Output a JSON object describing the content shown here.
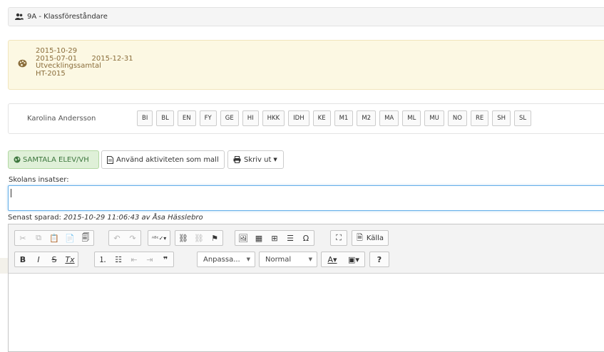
{
  "header": {
    "title": "9A - Klassföreståndare",
    "icon": "users-icon"
  },
  "info": {
    "icon": "palette-icon",
    "date": "2015-10-29",
    "period_start": "2015-07-01",
    "period_end": "2015-12-31",
    "activity": "Utvecklingssamtal",
    "term": "HT-2015"
  },
  "student": {
    "name": "Karolina Andersson",
    "subjects": [
      "BI",
      "BL",
      "EN",
      "FY",
      "GE",
      "HI",
      "HKK",
      "IDH",
      "KE",
      "M1",
      "M2",
      "MA",
      "ML",
      "MU",
      "NO",
      "RE",
      "SH",
      "SL"
    ]
  },
  "actions": {
    "talk_label": "SAMTALA ELEV/VH",
    "template_label": "Använd aktiviteten som mall",
    "print_label": "Skriv ut"
  },
  "form": {
    "field_label": "Skolans insatser:",
    "field_value": "",
    "saved_prefix": "Senast sparad:",
    "saved_text": "2015-10-29 11:06:43 av Åsa Hässlebro"
  },
  "editor": {
    "source_label": "Källa",
    "format_label": "Anpassa...",
    "style_label": "Normal",
    "help_label": "?"
  },
  "colors": {
    "info_bg": "#fcf8e3",
    "info_text": "#8a6d3b",
    "success_bg": "#dff0d8",
    "focus": "#66afe9"
  }
}
